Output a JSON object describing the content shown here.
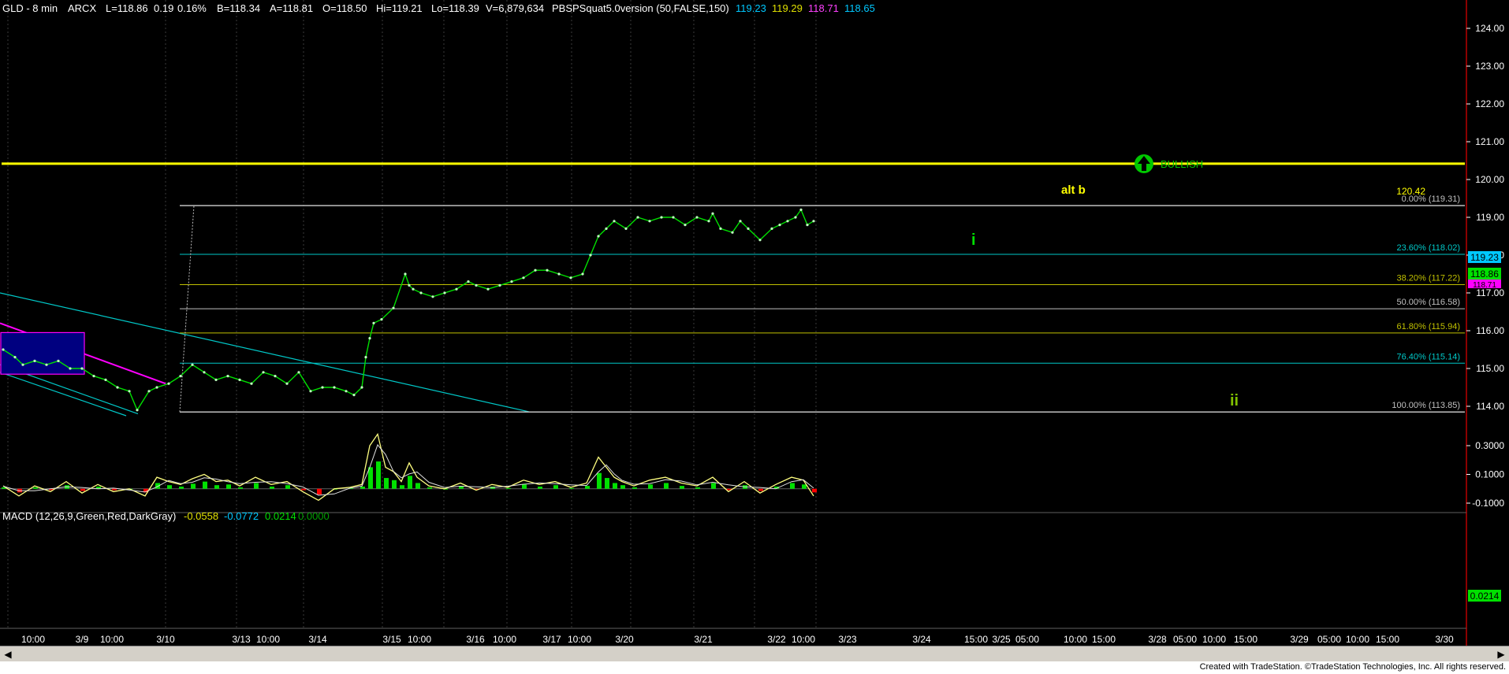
{
  "header": {
    "symbol": "GLD - 8 min",
    "exchange": "ARCX",
    "last": "L=118.86",
    "change": "0.19",
    "change_pct": "0.16%",
    "bid": "B=118.34",
    "ask": "A=118.81",
    "open": "O=118.50",
    "high": "Hi=119.21",
    "low": "Lo=118.39",
    "volume": "V=6,879,634",
    "indicator": "PBSPSquat5.0version (50,FALSE,150)",
    "ind_values": [
      "119.23",
      "119.29",
      "118.71",
      "118.65"
    ]
  },
  "macd_header": {
    "label": "MACD (12,26,9,Green,Red,DarkGray)",
    "values": [
      "-0.0558",
      "-0.0772",
      "0.0214",
      "0.0000"
    ]
  },
  "colors": {
    "background": "#000000",
    "price": "#00e000",
    "alt_b_line": "#ffff00",
    "fib_line": "#c0c0c0",
    "channel": "#00c8c8",
    "magenta": "#ff00ff",
    "macd": "#ffff80",
    "hist_pos": "#00e000",
    "hist_neg": "#ff0000",
    "bullish": "#00c800"
  },
  "annotations": {
    "alt_b": "alt b",
    "alt_b_value": "120.42",
    "wave_i": "i",
    "wave_ii": "ii",
    "bullish": "BULLISH"
  },
  "price_badges": [
    "119.23",
    "118.86",
    "118.71"
  ],
  "macd_badge": "0.0214",
  "footer_text": "Created with TradeStation. ©TradeStation Technologies, Inc. All rights reserved.",
  "chart_data": {
    "type": "line",
    "title": "GLD - 8 min",
    "ylim": [
      113.7,
      124.3
    ],
    "price_ticks": [
      "124.00",
      "123.00",
      "122.00",
      "121.00",
      "120.00",
      "119.00",
      "118.00",
      "117.00",
      "116.00",
      "115.00",
      "114.00"
    ],
    "macd_ticks": [
      "0.3000",
      "0.1000",
      "-0.1000"
    ],
    "x_labels": [
      "10:00",
      "3/9",
      "10:00",
      "3/10",
      "3/13",
      "10:00",
      "3/14",
      "3/15",
      "10:00",
      "3/16",
      "10:00",
      "3/17",
      "10:00",
      "3/20",
      "3/21",
      "3/22",
      "10:00",
      "3/23",
      "3/24",
      "15:00",
      "3/25",
      "05:00",
      "10:00",
      "15:00",
      "3/28",
      "05:00",
      "10:00",
      "15:00",
      "3/29",
      "05:00",
      "10:00",
      "15:00",
      "3/30"
    ],
    "fib_levels": [
      {
        "label": "0.00%",
        "value": 119.31
      },
      {
        "label": "23.60%",
        "value": 118.02
      },
      {
        "label": "38.20%",
        "value": 117.22
      },
      {
        "label": "50.00%",
        "value": 116.58
      },
      {
        "label": "61.80%",
        "value": 115.94
      },
      {
        "label": "76.40%",
        "value": 115.14
      },
      {
        "label": "100.00%",
        "value": 113.85
      }
    ],
    "fib_label_colors": [
      "#c0c0c0",
      "#00c8c8",
      "#c0c000",
      "#c0c0c0",
      "#c0c000",
      "#00c8c8",
      "#c0c0c0"
    ],
    "alt_b_level": 120.42,
    "series": [
      {
        "name": "GLD",
        "x": [
          0,
          15,
          25,
          40,
          55,
          70,
          85,
          100,
          115,
          130,
          145,
          160,
          170,
          185,
          195,
          210,
          225,
          240,
          255,
          270,
          285,
          300,
          315,
          330,
          345,
          360,
          375,
          390,
          405,
          420,
          435,
          445,
          455,
          460,
          465,
          470,
          480,
          495,
          510,
          515,
          520,
          530,
          545,
          560,
          575,
          590,
          600,
          615,
          630,
          645,
          660,
          675,
          690,
          705,
          720,
          735,
          745,
          755,
          765,
          775,
          790,
          805,
          820,
          835,
          850,
          865,
          880,
          895,
          900,
          910,
          925,
          935,
          945,
          960,
          975,
          985,
          995,
          1005,
          1012,
          1020,
          1028
        ],
        "y": [
          115.5,
          115.3,
          115.1,
          115.2,
          115.1,
          115.2,
          115.0,
          115.0,
          114.8,
          114.7,
          114.5,
          114.4,
          113.9,
          114.4,
          114.5,
          114.6,
          114.8,
          115.1,
          114.9,
          114.7,
          114.8,
          114.7,
          114.6,
          114.9,
          114.8,
          114.6,
          114.9,
          114.4,
          114.5,
          114.5,
          114.4,
          114.3,
          114.5,
          115.3,
          115.8,
          116.2,
          116.3,
          116.6,
          117.5,
          117.2,
          117.1,
          117.0,
          116.9,
          117.0,
          117.1,
          117.3,
          117.2,
          117.1,
          117.2,
          117.3,
          117.4,
          117.6,
          117.6,
          117.5,
          117.4,
          117.5,
          118.0,
          118.5,
          118.7,
          118.9,
          118.7,
          119.0,
          118.9,
          119.0,
          119.0,
          118.8,
          119.0,
          118.9,
          119.1,
          118.7,
          118.6,
          118.9,
          118.7,
          118.4,
          118.7,
          118.8,
          118.9,
          119.0,
          119.2,
          118.8,
          118.9
        ]
      }
    ],
    "macd": {
      "x": [
        0,
        20,
        40,
        60,
        80,
        100,
        120,
        140,
        160,
        180,
        195,
        210,
        225,
        240,
        255,
        270,
        285,
        300,
        320,
        340,
        360,
        380,
        400,
        420,
        440,
        455,
        465,
        475,
        485,
        495,
        505,
        515,
        525,
        540,
        560,
        580,
        600,
        620,
        640,
        660,
        680,
        700,
        720,
        740,
        755,
        765,
        775,
        785,
        800,
        820,
        840,
        860,
        880,
        900,
        920,
        940,
        960,
        980,
        1000,
        1015,
        1028
      ],
      "y": [
        0.02,
        -0.05,
        0.02,
        -0.02,
        0.05,
        -0.03,
        0.03,
        -0.02,
        0.0,
        -0.05,
        0.08,
        0.05,
        0.03,
        0.07,
        0.1,
        0.05,
        0.06,
        0.02,
        0.08,
        0.03,
        0.05,
        -0.02,
        -0.08,
        0.0,
        0.01,
        0.03,
        0.3,
        0.38,
        0.15,
        0.12,
        0.05,
        0.18,
        0.08,
        0.02,
        0.0,
        0.04,
        -0.01,
        0.03,
        0.01,
        0.06,
        0.03,
        0.05,
        0.01,
        0.04,
        0.22,
        0.15,
        0.08,
        0.05,
        0.02,
        0.06,
        0.08,
        0.04,
        0.02,
        0.08,
        -0.02,
        0.05,
        -0.03,
        0.03,
        0.08,
        0.06,
        -0.05
      ]
    }
  }
}
